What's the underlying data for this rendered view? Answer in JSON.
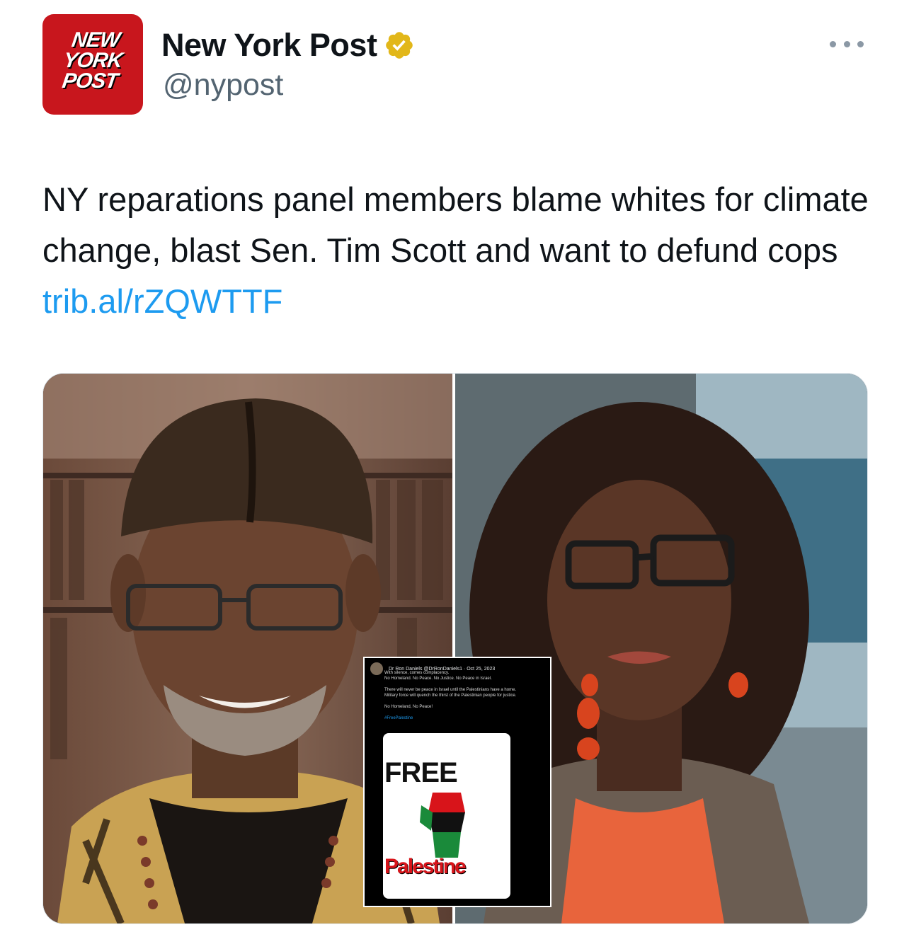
{
  "account": {
    "avatar_logo": [
      "NEW",
      "YORK",
      "POST"
    ],
    "name": "New York Post",
    "handle": "@nypost",
    "verified_icon": "verified-badge-gold-icon",
    "more_icon": "more-options-icon"
  },
  "tweet": {
    "text": "NY reparations panel members blame whites for climate change, blast Sen. Tim Scott and want to defund cops ",
    "link": "trib.al/rZQWTTF"
  },
  "media": {
    "left_photo": "photo-man-in-kufi-and-glasses",
    "right_photo": "photo-woman-with-locs-and-glasses",
    "inset_post": {
      "author": "Dr Ron Daniels @DrRonDaniels1 · Oct 25, 2023",
      "lines": [
        "With silence, comes complacency.",
        "No Homeland. No Peace. No Justice. No Peace in Israel.",
        "There will never be peace in Israel until the Palestinians have a home.",
        "Military force will quench the thirst of the Palestinian people for justice.",
        "No Homeland, No Peace!"
      ],
      "hashtag": "#FreePalestine",
      "card_top": "FREE",
      "card_bottom": "Palestine"
    }
  },
  "colors": {
    "brand_red": "#c8161d",
    "link_blue": "#1d9bf0",
    "verified_gold": "#e2b719",
    "text": "#0f1419",
    "secondary": "#536471"
  }
}
